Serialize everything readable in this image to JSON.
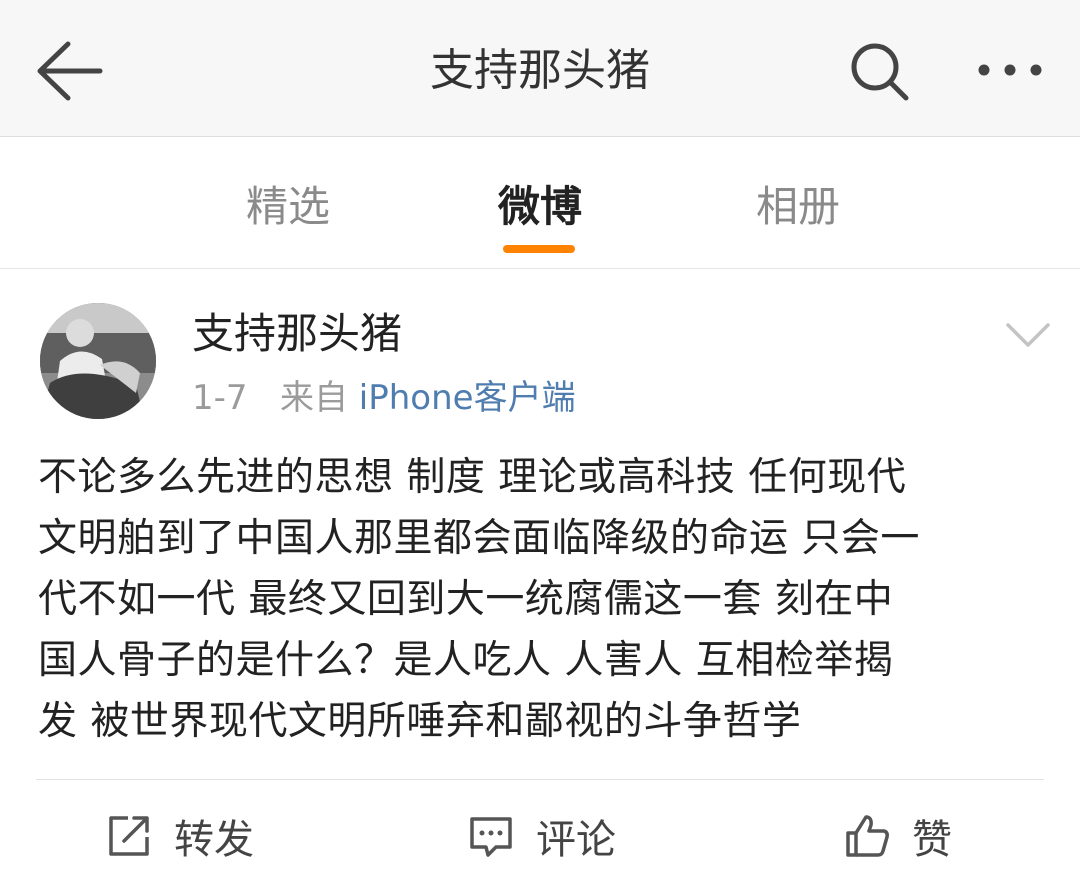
{
  "header": {
    "title": "支持那头猪",
    "back_icon": "back-arrow-icon",
    "search_icon": "search-icon",
    "more_icon": "more-dots-icon"
  },
  "tabs": [
    {
      "label": "精选",
      "active": false
    },
    {
      "label": "微博",
      "active": true
    },
    {
      "label": "相册",
      "active": false
    }
  ],
  "colors": {
    "accent": "#ff8200",
    "link": "#507daf"
  },
  "post": {
    "username": "支持那头猪",
    "date": "1-7",
    "from_label": "来自",
    "source": "iPhone客户端",
    "lines": [
      "不论多么先进的思想 制度 理论或高科技 任何现代",
      "文明舶到了中国人那里都会面临降级的命运 只会一",
      "代不如一代 最终又回到大一统腐儒这一套 刻在中",
      "国人骨子的是什么？是人吃人 人害人 互相检举揭",
      "发 被世界现代文明所唾弃和鄙视的斗争哲学"
    ]
  },
  "actions": {
    "repost": "转发",
    "comment": "评论",
    "like": "赞"
  }
}
